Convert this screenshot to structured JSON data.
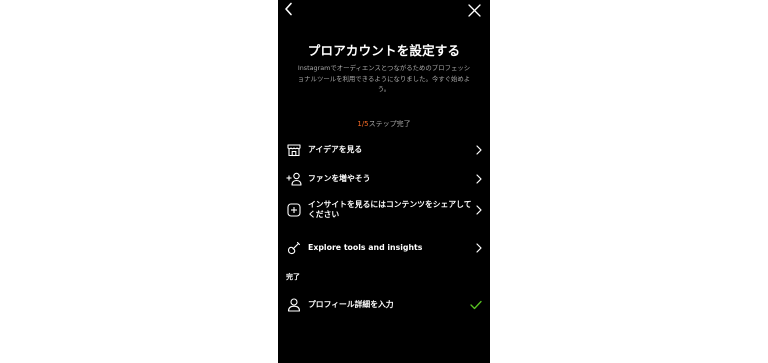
{
  "header": {
    "back_icon": "chevron-left-icon",
    "close_icon": "close-icon"
  },
  "title": "プロアカウントを設定する",
  "description": "Instagramでオーディエンスとつながるためのプロフェッショナルツールを利用できるようになりました。今すぐ始めよう。",
  "progress": {
    "current": "1/5",
    "suffix": "ステップ完了"
  },
  "todo_items": [
    {
      "label": "アイデアを見る",
      "icon": "storefront-icon"
    },
    {
      "label": "ファンを増やそう",
      "icon": "add-person-icon"
    },
    {
      "label": "インサイトを見るにはコンテンツをシェアしてください",
      "icon": "plus-square-icon"
    },
    {
      "label": "Explore tools and insights",
      "icon": "guitar-icon"
    }
  ],
  "completed_section": {
    "title": "完了",
    "items": [
      {
        "label": "プロフィール詳細を入力",
        "icon": "person-icon",
        "status_icon": "checkmark-icon"
      }
    ]
  },
  "colors": {
    "background": "#000000",
    "accent_progress": "#f56a25",
    "check": "#58c322",
    "secondary_text": "#a8a8a8"
  }
}
